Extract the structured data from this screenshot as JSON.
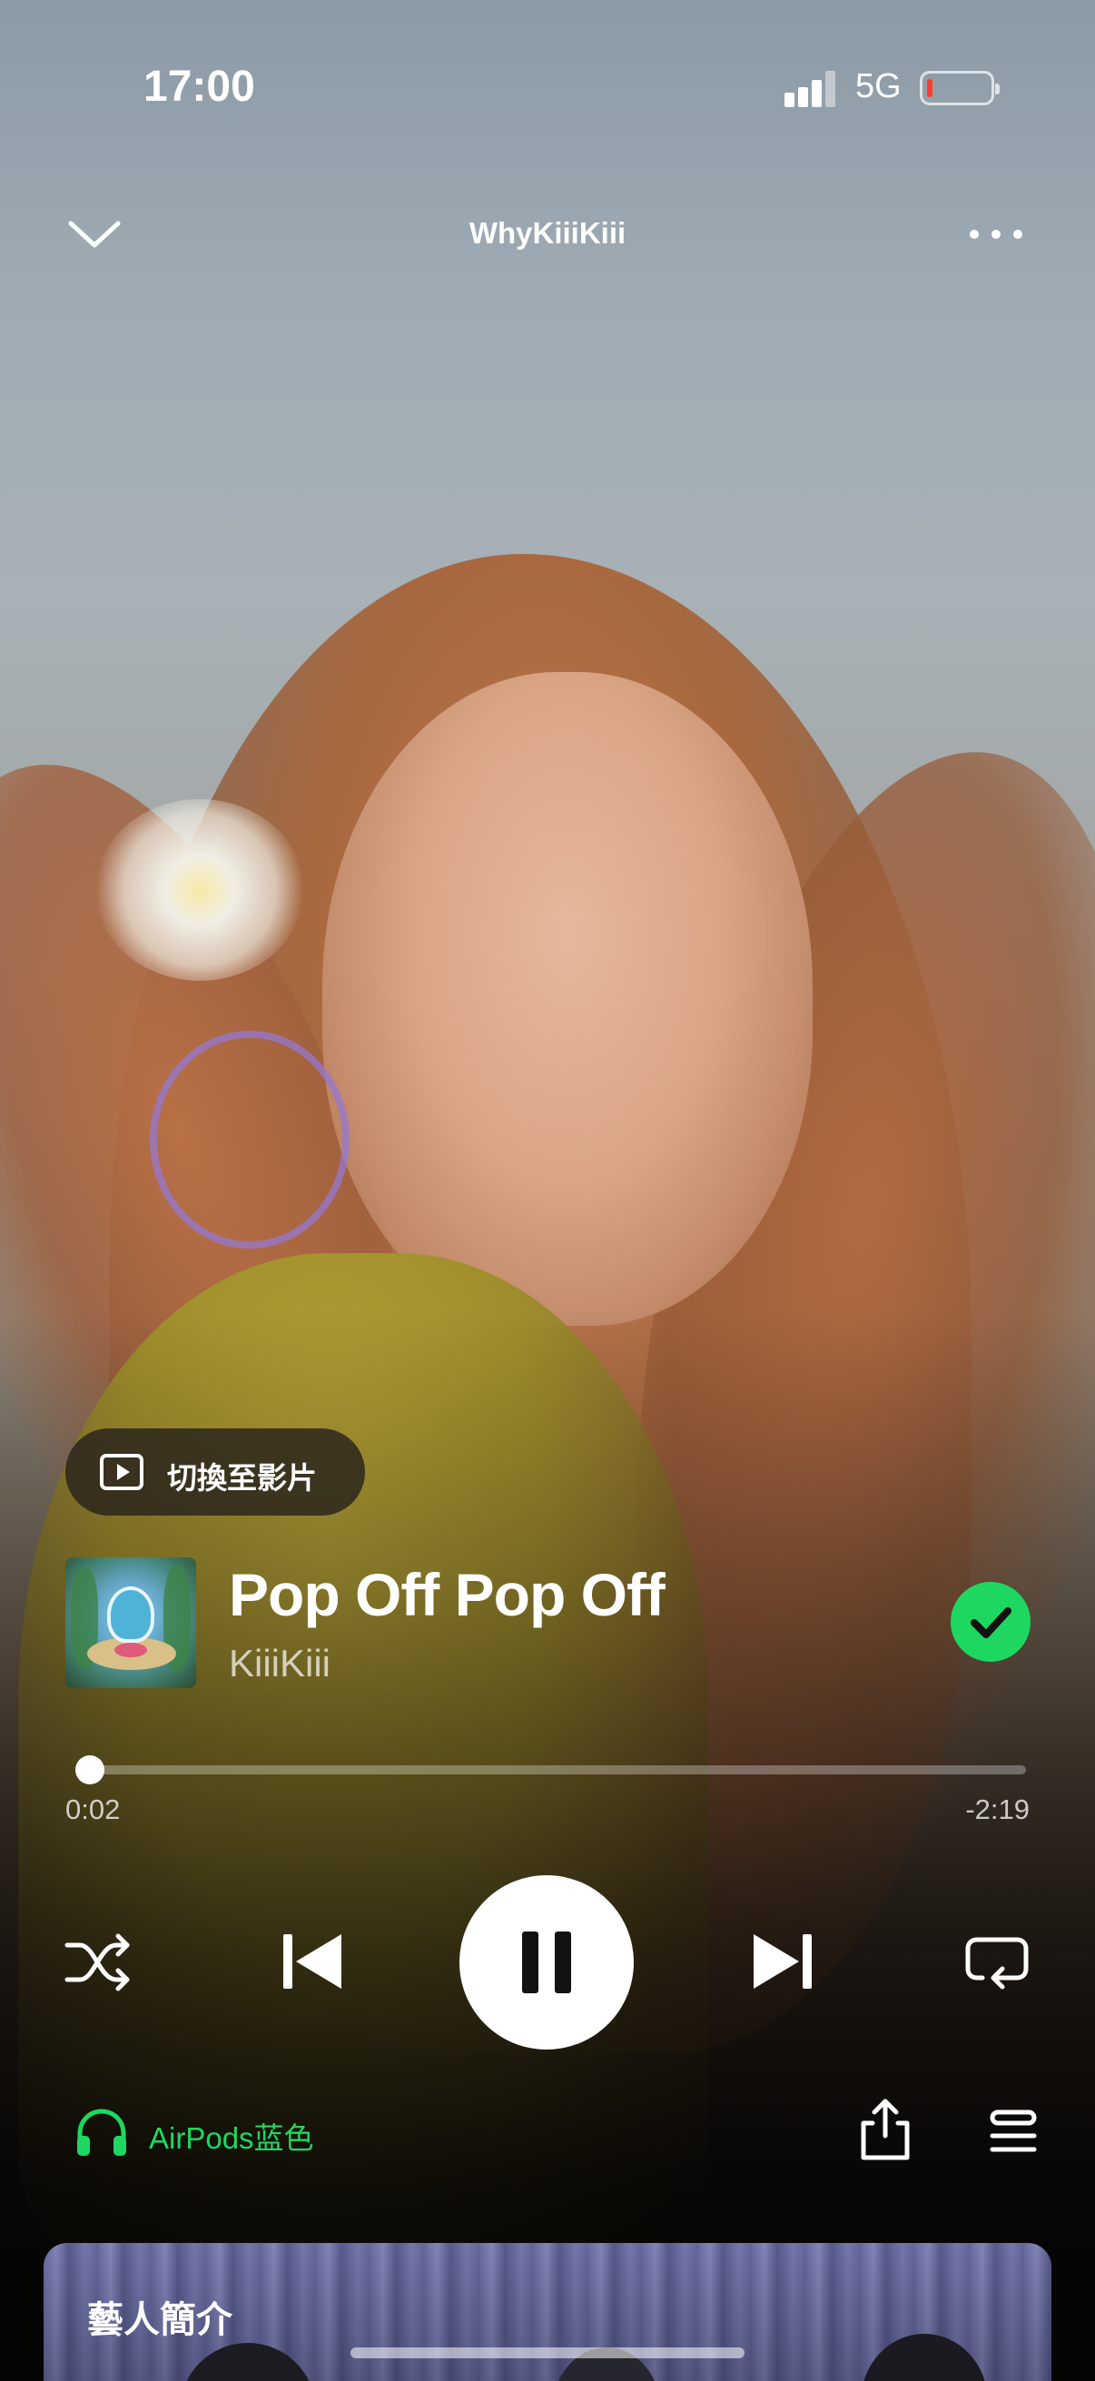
{
  "status_bar": {
    "time": "17:00",
    "network": "5G",
    "battery_level": 0.08
  },
  "header": {
    "title": "WhyKiiiKiii",
    "collapse_icon": "chevron-down-icon",
    "more_icon": "more-dots-icon"
  },
  "video_switch": {
    "label": "切換至影片",
    "icon": "play-video-icon"
  },
  "track": {
    "title": "Pop Off Pop Off",
    "artist": "KiiiKiii",
    "saved": true
  },
  "progress": {
    "elapsed": "0:02",
    "remaining": "-2:19",
    "fraction": 0.014
  },
  "controls": {
    "shuffle": "shuffle-icon",
    "previous": "skip-previous-icon",
    "pause": "pause-icon",
    "next": "skip-next-icon",
    "repeat": "repeat-icon"
  },
  "device": {
    "label": "AirPods蓝色",
    "icon": "headphones-icon"
  },
  "actions": {
    "share": "share-icon",
    "queue": "queue-icon"
  },
  "artist_card": {
    "title": "藝人簡介"
  },
  "colors": {
    "accent_green": "#1ed760",
    "battery_low": "#ff3b30"
  }
}
